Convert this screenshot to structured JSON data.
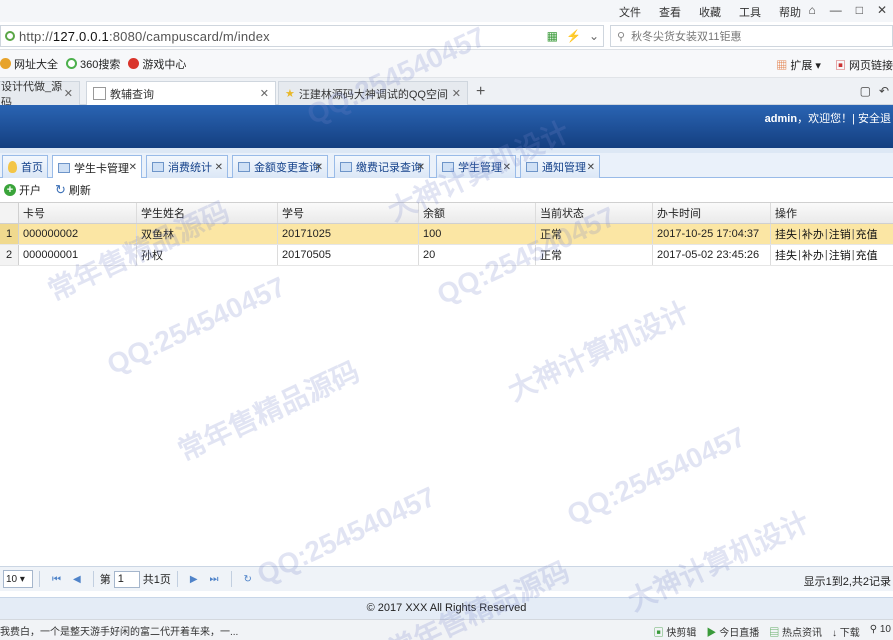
{
  "browser": {
    "menus": [
      "文件",
      "查看",
      "收藏",
      "工具",
      "帮助"
    ],
    "url_host": "127.0.0.1",
    "url_rest": ":8080/campuscard/m/index",
    "url_prefix": "http://",
    "search_text": "秋冬尖货女装双11钜惠",
    "bookmarks": [
      "网址大全",
      "360搜索",
      "游戏中心"
    ],
    "bookmark_right": [
      "扩展",
      "网页链接"
    ],
    "tabs": [
      {
        "label": "设计代做_源码"
      },
      {
        "label": "教辅查询"
      },
      {
        "label": "汪建林源码大神调试的QQ空间 [E"
      }
    ]
  },
  "app": {
    "welcome_user": "admin",
    "welcome_text": "，欢迎您！| 安全退",
    "tabs": [
      {
        "label": "首页"
      },
      {
        "label": "学生卡管理"
      },
      {
        "label": "消费统计"
      },
      {
        "label": "金额变更查询"
      },
      {
        "label": "缴费记录查询"
      },
      {
        "label": "学生管理"
      },
      {
        "label": "通知管理"
      }
    ],
    "toolbar": {
      "add_label": "开户",
      "refresh_label": "刷新"
    },
    "columns": [
      "卡号",
      "学生姓名",
      "学号",
      "余额",
      "当前状态",
      "办卡时间",
      "操作"
    ],
    "rows": [
      {
        "num": "1",
        "card": "000000002",
        "name": "双鱼林",
        "sid": "20171025",
        "balance": "100",
        "status": "正常",
        "time": "2017-10-25 17:04:37"
      },
      {
        "num": "2",
        "card": "000000001",
        "name": "孙权",
        "sid": "20170505",
        "balance": "20",
        "status": "正常",
        "time": "2017-05-02 23:45:26"
      }
    ],
    "ops": [
      "挂失",
      "补办",
      "注销",
      "充值"
    ],
    "pager": {
      "page_size": "10",
      "page_prefix": "第",
      "page_value": "1",
      "page_suffix": "共1页",
      "info": "显示1到2,共2记录"
    },
    "footer": "© 2017 XXX All Rights Reserved"
  },
  "statusbar": {
    "news": "我费白，一个是整天游手好闲的富二代开着车来，一...",
    "items": [
      "快剪辑",
      "今日直播",
      "热点资讯",
      "下载",
      "10"
    ]
  },
  "watermark": [
    "QQ:254540457",
    "常年售精品源码",
    "大神计算机设计"
  ]
}
